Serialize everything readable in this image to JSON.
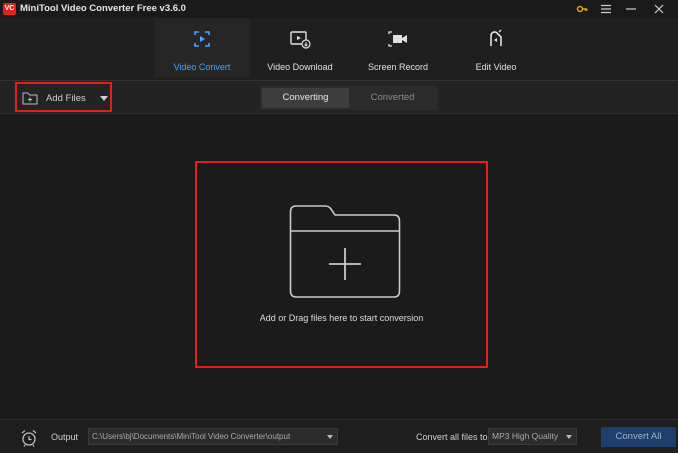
{
  "titlebar": {
    "logo_text": "VC",
    "title": "MiniTool Video Converter Free v3.6.0",
    "icons": [
      "key-icon",
      "menu-icon",
      "minimize-icon",
      "close-icon"
    ],
    "accent_color": "#e8a317"
  },
  "nav": {
    "tabs": [
      {
        "label": "Video Convert",
        "icon": "video-convert-icon",
        "active": true
      },
      {
        "label": "Video Download",
        "icon": "video-download-icon",
        "active": false
      },
      {
        "label": "Screen Record",
        "icon": "screen-record-icon",
        "active": false
      },
      {
        "label": "Edit Video",
        "icon": "edit-video-icon",
        "active": false
      }
    ],
    "active_color": "#4aa3ff"
  },
  "toolbar": {
    "add_files_label": "Add Files",
    "segments": [
      {
        "label": "Converting",
        "active": true
      },
      {
        "label": "Converted",
        "active": false
      }
    ]
  },
  "dropzone": {
    "text": "Add or Drag files here to start conversion",
    "highlight_color": "#e0201a"
  },
  "footer": {
    "output_label": "Output",
    "output_path": "C:\\Users\\bj\\Documents\\MiniTool Video Converter\\output",
    "convert_all_label": "Convert all files to",
    "format": "MP3 High Quality",
    "convert_button": "Convert All"
  }
}
